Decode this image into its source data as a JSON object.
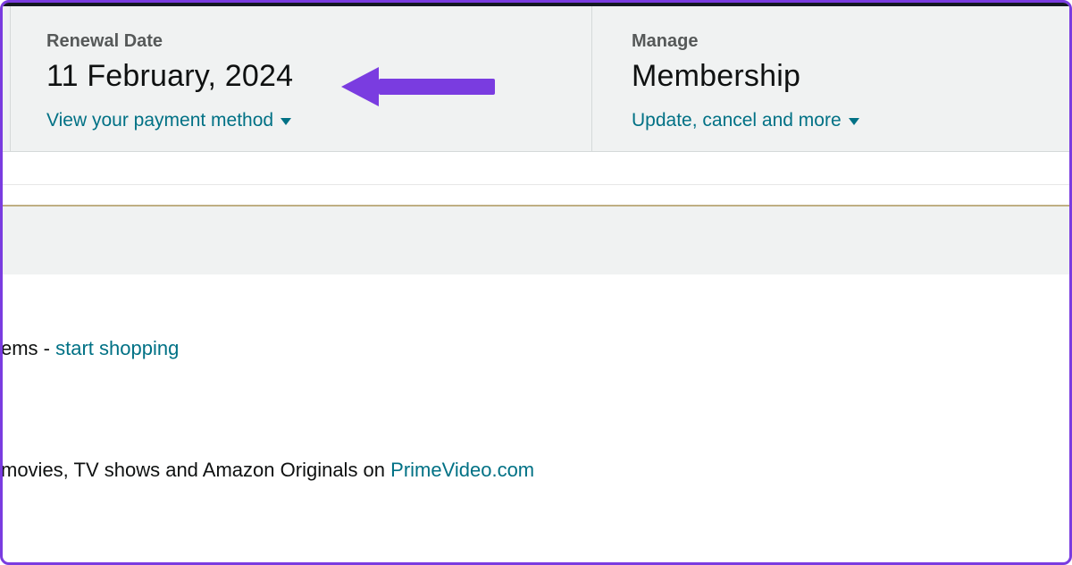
{
  "renewal": {
    "label": "Renewal Date",
    "value": "11 February, 2024",
    "link": "View your payment method"
  },
  "manage": {
    "label": "Manage",
    "value": "Membership",
    "link": "Update, cancel and more"
  },
  "items": {
    "fragment": "ems - ",
    "link": "start shopping"
  },
  "prime": {
    "fragment": "movies, TV shows and Amazon Originals on ",
    "link": "PrimeVideo.com"
  }
}
